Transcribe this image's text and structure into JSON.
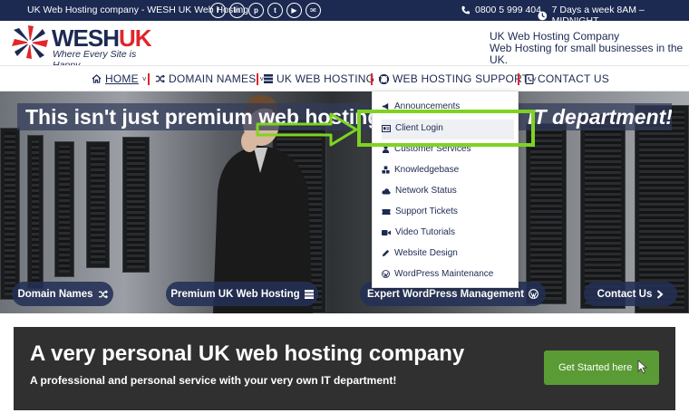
{
  "topbar": {
    "tagline": "UK Web Hosting company - WESH UK Web Hosting",
    "social_icons": [
      "facebook-icon",
      "linkedin-icon",
      "pinterest-icon",
      "twitter-icon",
      "youtube-icon",
      "mail-icon"
    ],
    "social_glyphs": [
      "f",
      "in",
      "p",
      "t",
      "▶",
      "✉"
    ],
    "phone": "0800 5 999 404",
    "hours": "7 Days a week 8AM – MIDNIGHT"
  },
  "header": {
    "logo_primary": "WESH",
    "logo_accent": "UK",
    "slogan": "Where Every Site is Happy",
    "company_line1": "UK Web Hosting Company",
    "company_line2": "Web Hosting for small businesses in the UK."
  },
  "nav": {
    "items": [
      {
        "label": "HOME",
        "icon": "home-icon",
        "active": true
      },
      {
        "label": "DOMAIN NAMES",
        "icon": "shuffle-icon"
      },
      {
        "label": "UK WEB HOSTING",
        "icon": "server-icon"
      },
      {
        "label": "WEB HOSTING SUPPORT",
        "icon": "lifering-icon"
      },
      {
        "label": "CONTACT US",
        "icon": "phone-book-icon"
      }
    ]
  },
  "hero": {
    "banner_normal": "This isn't just premium web hosting",
    "banner_italic": "IT department!",
    "buttons": [
      {
        "label": "Domain Names",
        "icon": "shuffle-icon"
      },
      {
        "label": "Premium UK Web Hosting",
        "icon": "server-icon"
      },
      {
        "label": "Expert WordPress Management",
        "icon": "wordpress-icon"
      },
      {
        "label": "Contact Us",
        "icon": "chevron-right-icon"
      }
    ]
  },
  "dropdown": {
    "items": [
      {
        "label": "Announcements",
        "icon": "megaphone-icon"
      },
      {
        "label": "Client Login",
        "icon": "id-card-icon",
        "highlighted": true
      },
      {
        "label": "Customer Services",
        "icon": "user-icon"
      },
      {
        "label": "Knowledgebase",
        "icon": "cubes-icon"
      },
      {
        "label": "Network Status",
        "icon": "cloud-icon"
      },
      {
        "label": "Support Tickets",
        "icon": "ticket-icon"
      },
      {
        "label": "Video Tutorials",
        "icon": "video-icon"
      },
      {
        "label": "Website Design",
        "icon": "pencil-icon"
      },
      {
        "label": "WordPress Maintenance",
        "icon": "wordpress-icon"
      }
    ]
  },
  "cta": {
    "title": "A very personal UK web hosting company",
    "subtitle": "A professional and personal service with your very own IT department!",
    "button": "Get Started here"
  },
  "colors": {
    "navy": "#1c2a52",
    "red": "#e0262b",
    "green": "#5a9b35",
    "annotation_green": "#7ed321",
    "cta_bg": "#303030"
  }
}
